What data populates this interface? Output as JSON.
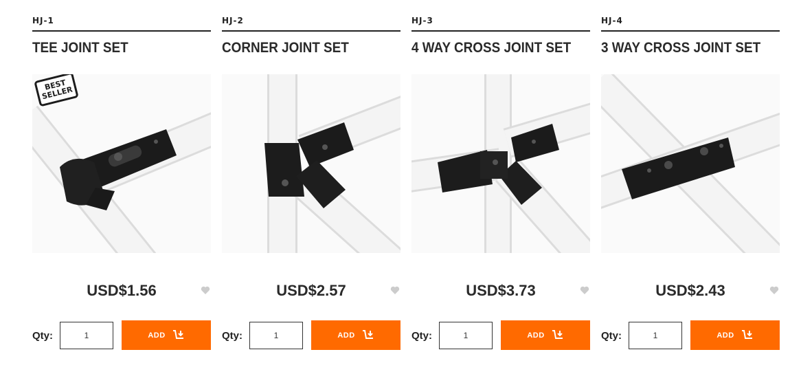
{
  "products": [
    {
      "sku": "HJ-1",
      "title": "TEE JOINT SET",
      "price": "USD$1.56",
      "badge": [
        "BEST",
        "SELLER"
      ],
      "qty": "1",
      "add_label": "ADD",
      "image_icon": "tee-joint-image"
    },
    {
      "sku": "HJ-2",
      "title": "CORNER JOINT SET",
      "price": "USD$2.57",
      "qty": "1",
      "add_label": "ADD",
      "image_icon": "corner-joint-image"
    },
    {
      "sku": "HJ-3",
      "title": "4 WAY CROSS JOINT SET",
      "price": "USD$3.73",
      "qty": "1",
      "add_label": "ADD",
      "image_icon": "four-way-joint-image"
    },
    {
      "sku": "HJ-4",
      "title": "3 WAY CROSS JOINT SET",
      "price": "USD$2.43",
      "qty": "1",
      "add_label": "ADD",
      "image_icon": "three-way-joint-image"
    }
  ],
  "qty_label": "Qty:",
  "icons": {
    "wishlist": "heart-icon",
    "cart": "cart-add-icon"
  },
  "colors": {
    "accent": "#ff6a00",
    "text": "#2a2a2a",
    "heart": "#cccccc"
  }
}
